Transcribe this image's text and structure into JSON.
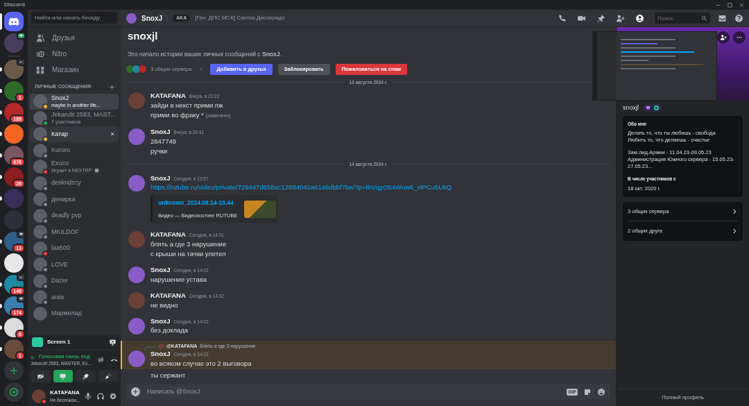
{
  "window": {
    "title": "Discord"
  },
  "server_rail": {
    "home": {
      "selected": true
    },
    "direct_messages": [
      {
        "screen": true,
        "live": true
      }
    ],
    "servers": [
      {
        "unread": true,
        "speaker": true
      },
      {
        "unread": true,
        "badge": "1"
      },
      {
        "unread": true,
        "badge": "185"
      },
      {
        "unread": true
      },
      {
        "unread": true,
        "badge": "676"
      },
      {
        "unread": true,
        "badge": "28"
      },
      {
        "unread": true
      },
      {
        "unread": false
      },
      {
        "unread": true,
        "badge": "13",
        "screen": true
      },
      {
        "unread": false
      },
      {
        "unread": true,
        "badge": "149",
        "speaker": true
      },
      {
        "unread": true,
        "badge": "174",
        "screen": true
      },
      {
        "unread": true,
        "badge": "6"
      },
      {
        "unread": true,
        "badge": "1"
      }
    ]
  },
  "sidebar": {
    "search_placeholder": "Найти или начать беседу",
    "nav": [
      {
        "kind": "friends",
        "label": "Друзья"
      },
      {
        "kind": "nitro",
        "label": "Nitro"
      },
      {
        "kind": "shop",
        "label": "Магазин"
      }
    ],
    "dm_header": "ЛИЧНЫЕ СООБЩЕНИЯ",
    "conversations": [
      {
        "name": "SnoxJ",
        "subtitle": "maybe in another life...",
        "color": "#f0b232",
        "selected": true,
        "hovered": false
      },
      {
        "name": "Jekarulit 2583, MAST...",
        "subtitle": "7 участников",
        "color": "#23a55a",
        "selected": false,
        "hovered": false
      },
      {
        "name": "Катар",
        "color": "#f0b232",
        "selected": false,
        "hovered": true
      },
      {
        "name": "Kuroro",
        "color": "#80848e",
        "selected": false,
        "hovered": false
      },
      {
        "name": "Exoco",
        "subtitle": "Играет в NEXTRP",
        "game_icon": true,
        "color": "#f23f43",
        "selected": false,
        "hovered": false
      },
      {
        "name": "deskridzcy",
        "color": "#80848e",
        "selected": false,
        "hovered": false
      },
      {
        "name": "денирка",
        "color": "#80848e",
        "selected": false,
        "hovered": false
      },
      {
        "name": "deadly pvp",
        "color": "#80848e",
        "selected": false,
        "hovered": false
      },
      {
        "name": "MKILDOF",
        "color": "#80848e",
        "selected": false,
        "hovered": false
      },
      {
        "name": "laa500",
        "color": "#f23f43",
        "selected": false,
        "hovered": false
      },
      {
        "name": "LOVE",
        "color": "#80848e",
        "selected": false,
        "hovered": false
      },
      {
        "name": "Dazer",
        "color": "#80848e",
        "selected": false,
        "hovered": false
      },
      {
        "name": "aniix",
        "color": "#80848e",
        "selected": false,
        "hovered": false
      },
      {
        "name": "Мармелад",
        "selected": false,
        "hovered": false
      }
    ]
  },
  "call_panel": {
    "stream": {
      "label": "Screen 1"
    },
    "voice": {
      "status": "Голосовая связь под",
      "channel": "Jekarulit 2583, MASTER, Ex..."
    },
    "controls": [
      {
        "kind": "camera",
        "on": false
      },
      {
        "kind": "screen",
        "on": true
      },
      {
        "kind": "activity",
        "on": false
      },
      {
        "kind": "soundboard",
        "on": false
      }
    ]
  },
  "user_panel": {
    "name": "KATAFANA",
    "status_text": "Не беспокои...",
    "color": "#f23f43"
  },
  "chat": {
    "header": {
      "name": "SnoxJ",
      "aka_label": "AKA",
      "aka": "[Ген. ДПС МСК] Сантиз Дисперадо",
      "search_placeholder": "Поиск",
      "profile_panel_open": true
    },
    "intro": {
      "title": "snoxjl",
      "text": "Это начало истории ваших личных сообщений с **SnoxJ**.",
      "mutual_servers": "3 общих сервера",
      "buttons": [
        {
          "kind": "primary",
          "label": "Добавить в друзья"
        },
        {
          "kind": "secondary",
          "label": "Заблокировать"
        },
        {
          "kind": "danger",
          "label": "Пожаловаться на спам"
        }
      ]
    },
    "messages": [
      {
        "kind": "divider",
        "text": "13 августа 2024 г."
      },
      {
        "kind": "group",
        "author": "KATAFANA",
        "color": "#6b4036",
        "time": "Вчера, в 20:22",
        "highlighted": false,
        "lines": [
          {
            "text": "зайди в некст прими пж"
          },
          {
            "text": "прими во фраку *",
            "edited": "(изменено)"
          }
        ]
      },
      {
        "kind": "group",
        "author": "SnoxJ",
        "color": "#8a5cc7",
        "time": "Вчера, в 20:41",
        "highlighted": false,
        "lines": [
          {
            "text": "2847749"
          },
          {
            "text": "ручки"
          }
        ]
      },
      {
        "kind": "divider",
        "text": "14 августа 2024 г."
      },
      {
        "kind": "group",
        "author": "SnoxJ",
        "color": "#8a5cc7",
        "time": "Сегодня, в 13:57",
        "highlighted": false,
        "lines": [
          {
            "text": "https://rutube.ru/video/private/729447d658ac12884042a61a9dbbf7be/?p=tbVqgO54Wow6_xlPCu5UkQ",
            "link": true
          }
        ],
        "embed": {
          "title": "unknown_2024.08.14-10.44",
          "description": "Видео — Видеохостинг RUTUBE"
        }
      },
      {
        "kind": "group",
        "author": "KATAFANA",
        "color": "#6b4036",
        "time": "Сегодня, в 14:01",
        "highlighted": false,
        "lines": [
          {
            "text": "блять а где 3 нарушение"
          },
          {
            "text": "с крыши на тачки улетел"
          }
        ]
      },
      {
        "kind": "group",
        "author": "SnoxJ",
        "color": "#8a5cc7",
        "time": "Сегодня, в 14:02",
        "highlighted": false,
        "lines": [
          {
            "text": "нарушение устава"
          }
        ]
      },
      {
        "kind": "group",
        "author": "KATAFANA",
        "color": "#6b4036",
        "time": "Сегодня, в 14:02",
        "highlighted": false,
        "lines": [
          {
            "text": "не видно"
          }
        ]
      },
      {
        "kind": "group",
        "author": "SnoxJ",
        "color": "#8a5cc7",
        "time": "Сегодня, в 14:02",
        "highlighted": false,
        "lines": [
          {
            "text": "без доклада"
          }
        ]
      },
      {
        "kind": "group",
        "author": "SnoxJ",
        "color": "#8a5cc7",
        "time": "Сегодня, в 14:02",
        "highlighted": true,
        "reply": {
          "author": "@KATAFANA",
          "text": "блять а где 3 нарушение"
        },
        "lines": [
          {
            "text": "во всяком случае это 2 выговора"
          }
        ]
      },
      {
        "kind": "line",
        "text": "ты сержант"
      }
    ],
    "composer": {
      "placeholder": "Написать @SnoxJ",
      "gif_label": "GIF"
    }
  },
  "profile": {
    "username": "snoxjl",
    "about_heading": "Обо мне",
    "about": [
      [
        "Делать то, что ты любишь - свобода",
        "Любить то, что делаешь - счастье"
      ],
      [
        "Зам.лид.Армии - 11.04.23-09.05.23",
        "Администрация Южного сервера - 15.05.23-27.05.23..."
      ]
    ],
    "member_since_heading": "В числе участников с",
    "member_since": "18 окт. 2020 г.",
    "links": [
      {
        "label": "3 общих сервера"
      },
      {
        "label": "2 общих друга"
      }
    ],
    "footer": "Полный профиль"
  }
}
